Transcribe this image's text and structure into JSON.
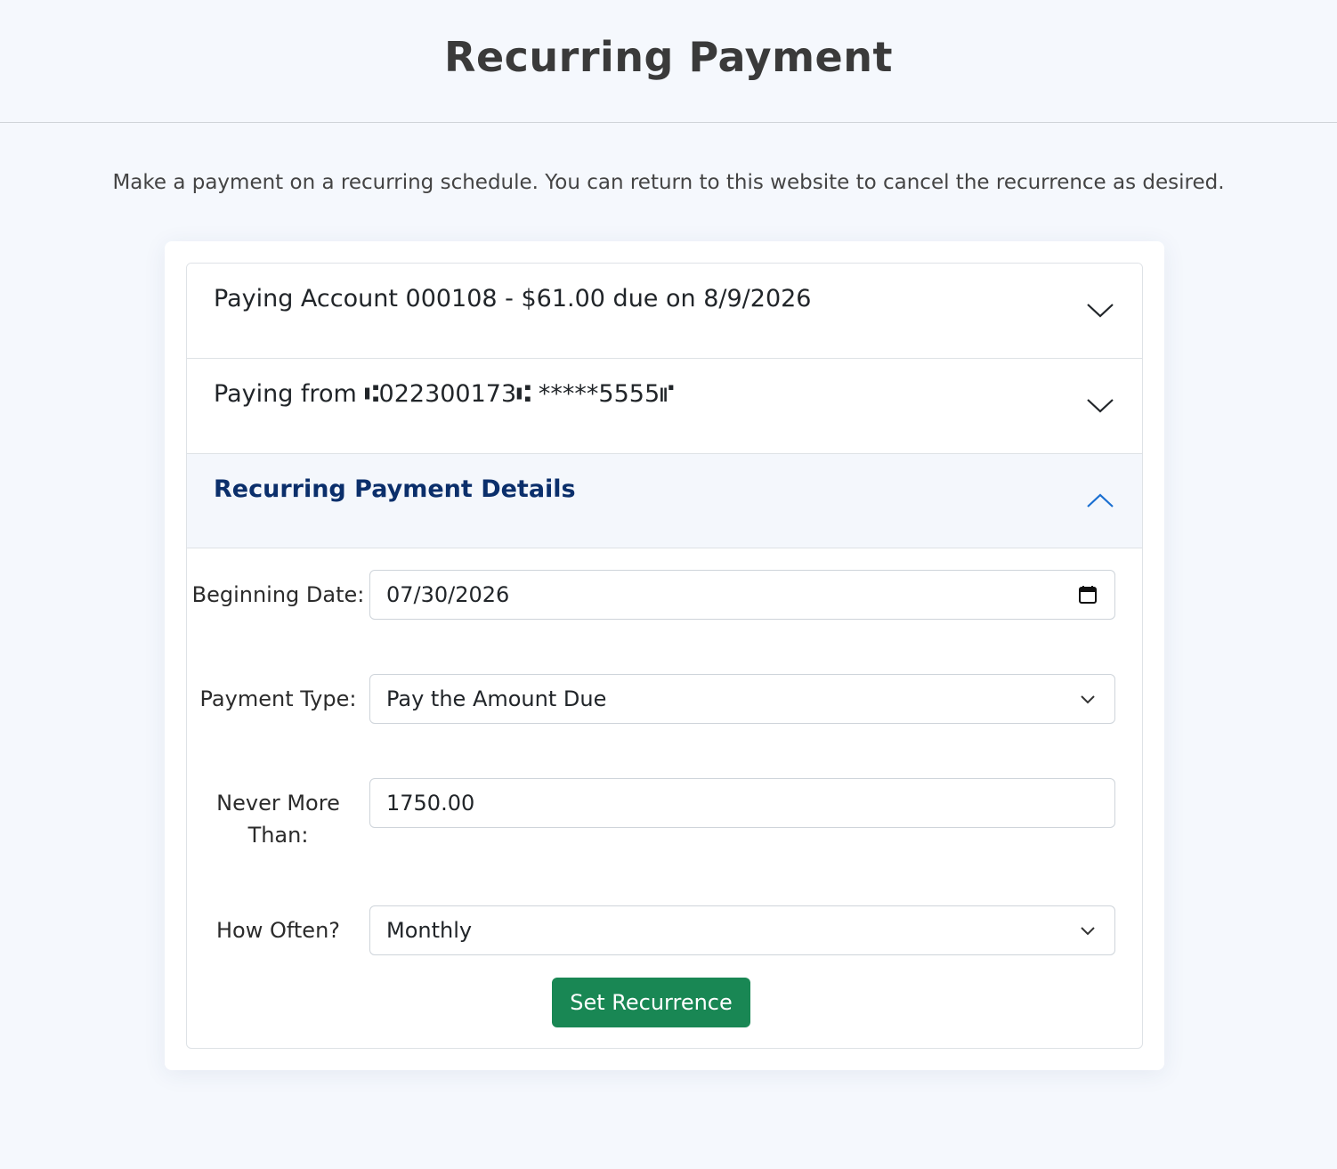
{
  "header": {
    "title": "Recurring Payment"
  },
  "intro": "Make a payment on a recurring schedule. You can return to this website to cancel the recurrence as desired.",
  "accordion": {
    "account": {
      "label": "Paying Account 000108 - $61.00 due on 8/9/2026"
    },
    "source": {
      "label": "Paying from ⑆022300173⑆ *****5555⑈"
    },
    "details": {
      "label": "Recurring Payment Details",
      "accent_color": "#0b2f6b",
      "chevron_color": "#1a6fd1"
    }
  },
  "form": {
    "beginning_date": {
      "label": "Beginning Date:",
      "value": "07/30/2026",
      "icon": "calendar-icon"
    },
    "payment_type": {
      "label": "Payment Type:",
      "value": "Pay the Amount Due",
      "icon": "chevron-down-icon"
    },
    "never_more_than": {
      "label": "Never More Than:",
      "value": "1750.00"
    },
    "how_often": {
      "label": "How Often?",
      "value": "Monthly",
      "icon": "chevron-down-icon"
    },
    "submit_label": "Set Recurrence",
    "submit_color": "#198754"
  }
}
